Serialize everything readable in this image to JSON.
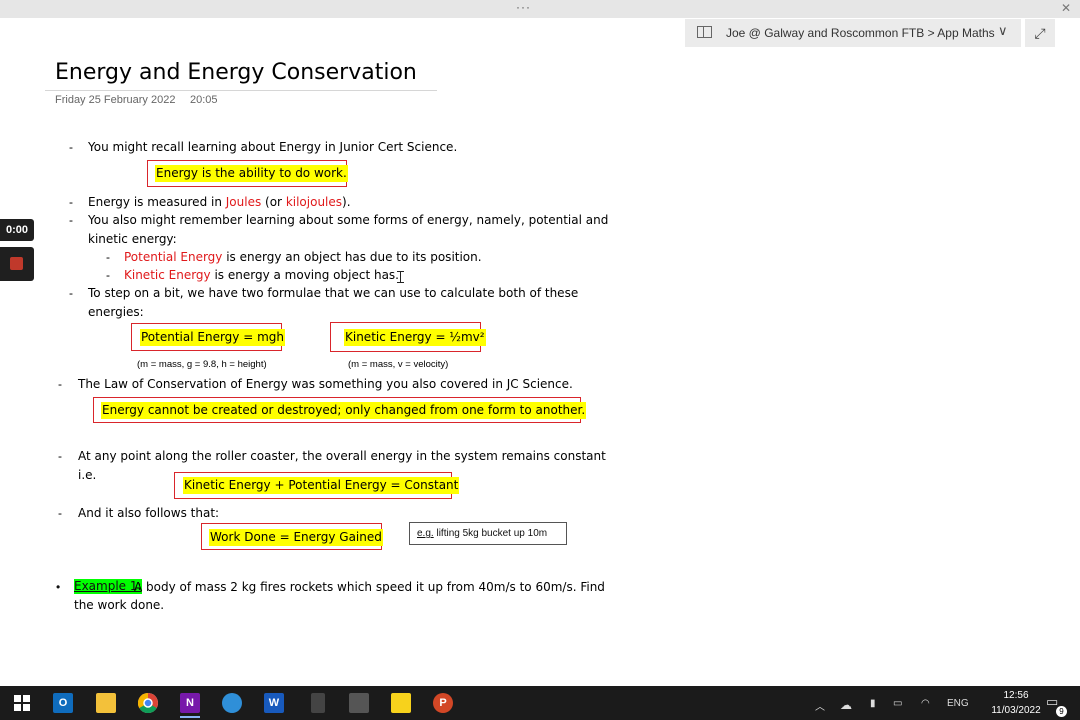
{
  "window": {
    "dots": "···",
    "close": "✕"
  },
  "notebar": {
    "breadcrumb": "Joe @ Galway and Roscommon FTB > App Maths",
    "chevron": "∨",
    "expand": "⤢"
  },
  "page": {
    "title": "Energy and Energy Conservation",
    "date": "Friday 25 February 2022",
    "time": "20:05"
  },
  "recorder": {
    "time": "0:00"
  },
  "content": {
    "l1": "You might recall learning about Energy in Junior Cert Science.",
    "box1": "Energy is the ability to do work.",
    "l2a": "Energy is measured in ",
    "l2b": "Joules",
    "l2c": " (or ",
    "l2d": "kilojoules",
    "l2e": ").",
    "l3a": "You also might remember learning about some forms of energy, namely, potential and",
    "l3b": "kinetic energy:",
    "l4a": "Potential Energy",
    "l4b": " is energy an object has due to its position.",
    "l5a": "Kinetic Energy",
    "l5b": " is energy a moving object has.",
    "l6a": "To step on a bit, we have two formulae that we can use to calculate both of these",
    "l6b": "energies:",
    "pe_formula": "Potential Energy = mgh",
    "ke_formula": "Kinetic Energy = ½mv²",
    "pe_note": "(m = mass, g = 9.8, h = height)",
    "ke_note": "(m = mass, v = velocity)",
    "l7": "The Law of Conservation of Energy was something you also covered in JC Science.",
    "box2": "Energy cannot be created or destroyed; only changed from one form to another.",
    "l8a": "At any point along the roller coaster, the overall energy in the system remains constant",
    "l8b": "i.e.",
    "box3": "Kinetic Energy + Potential Energy = Constant",
    "l9": "And it also follows that:",
    "box4": "Work Done = Energy Gained",
    "eg_label": "e.g.",
    "eg_text": " lifting 5kg bucket up 10m",
    "ex_label": "Example 1:",
    "ex_a": " A body of mass 2 kg fires rockets which speed it up from 40m/s to 60m/s. Find",
    "ex_b": "the work done."
  },
  "taskbar": {
    "apps": [
      "windows-logo",
      "outlook",
      "file-explorer",
      "chrome",
      "onenote",
      "app",
      "word",
      "phone",
      "calculator",
      "sticky-notes",
      "powerpoint"
    ],
    "outlook_letter": "O",
    "onenote_letter": "N",
    "word_letter": "W",
    "powerpoint_letter": "P",
    "lang": "ENG",
    "clock_time": "12:56",
    "clock_date": "11/03/2022",
    "notif_count": "9"
  },
  "colors": {
    "highlight": "#ffff00",
    "box_border": "#d9252b",
    "red_text": "#e0191b",
    "example_highlight": "#00ff00"
  }
}
